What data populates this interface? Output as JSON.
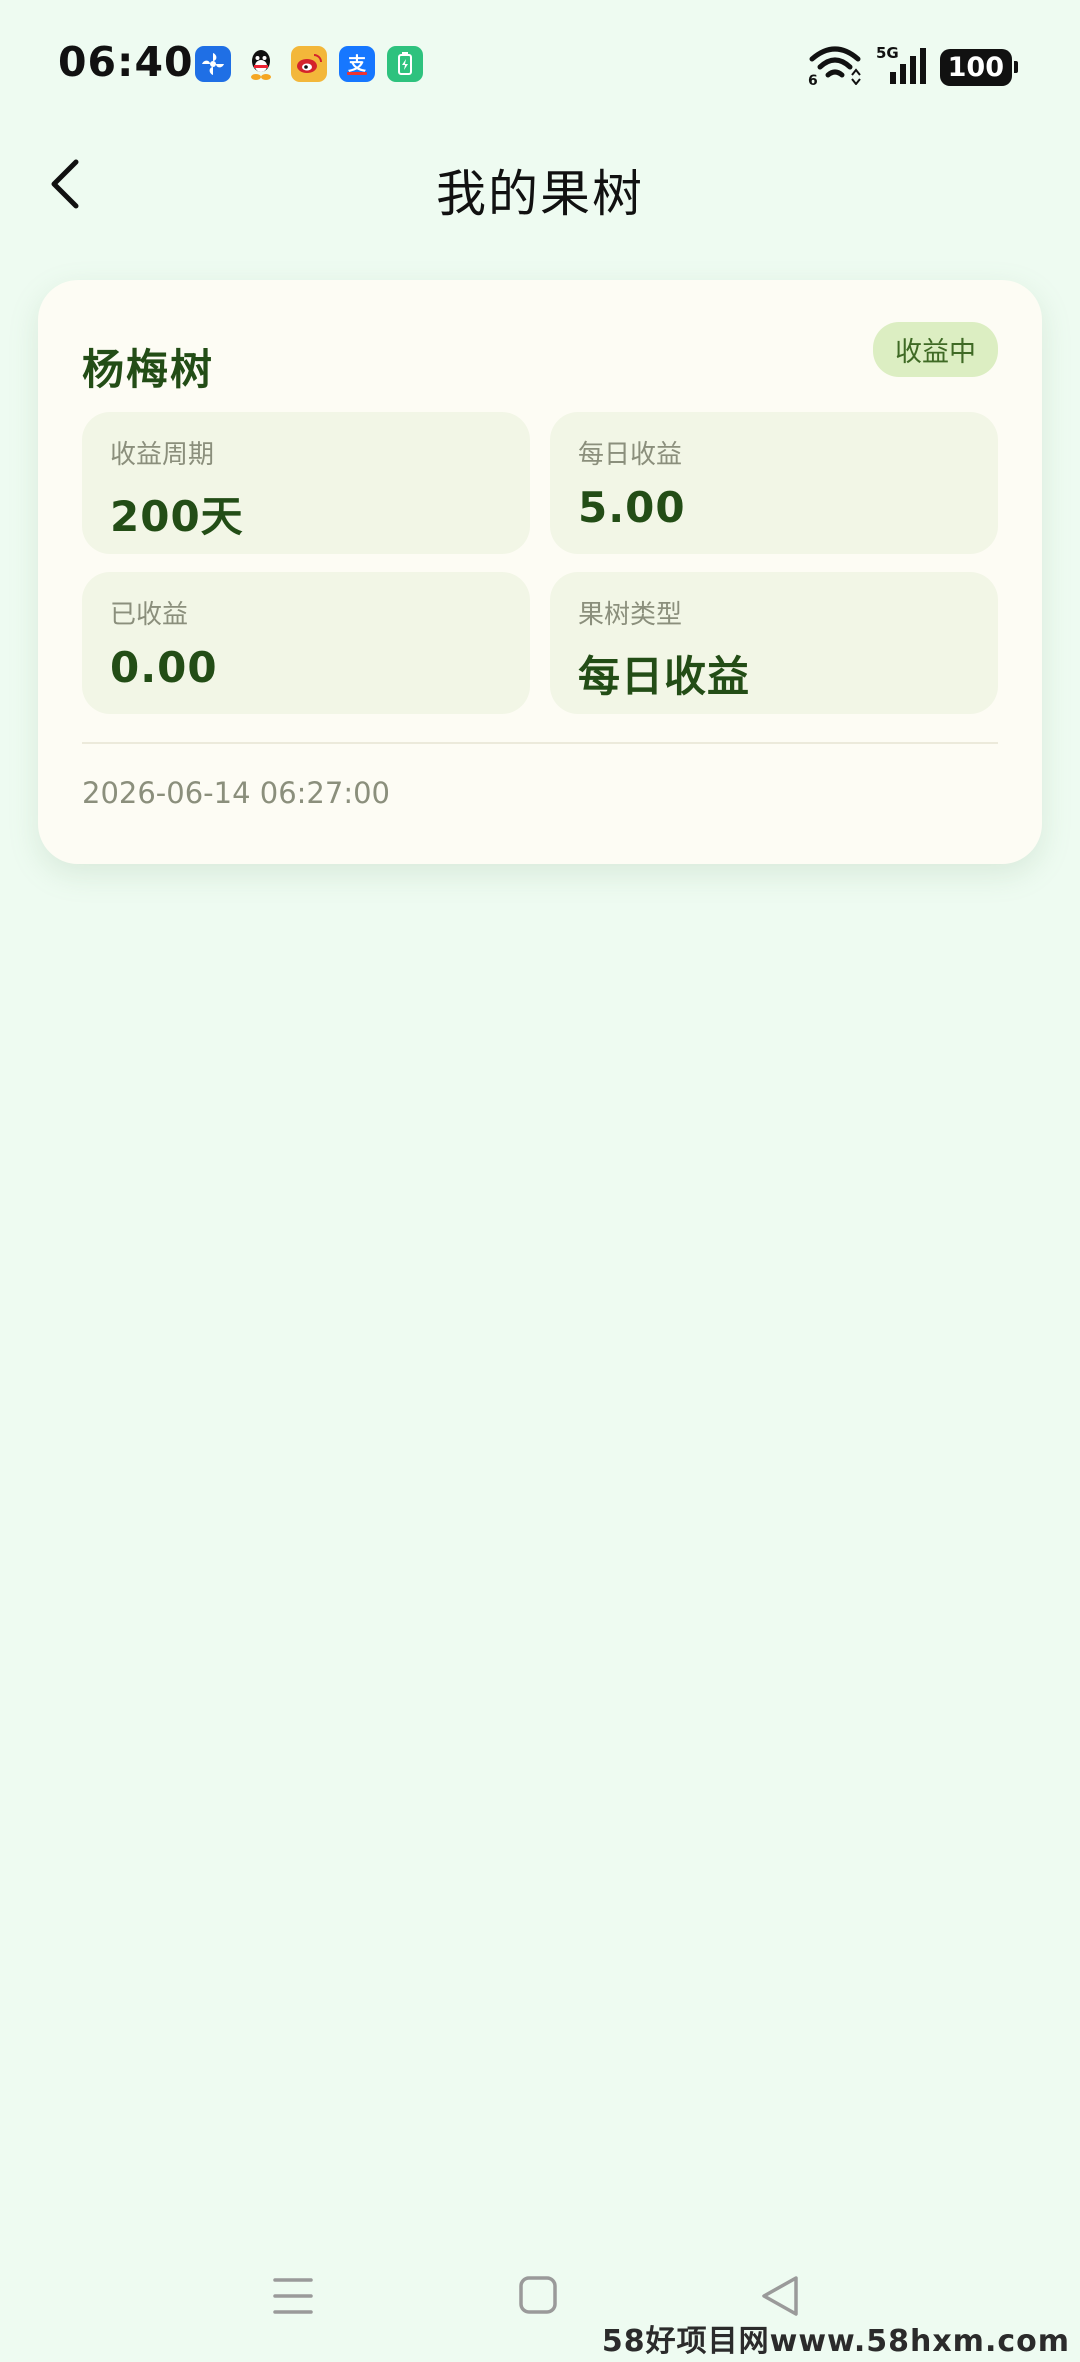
{
  "status_bar": {
    "time": "06:40",
    "apps": [
      "fan-app-icon",
      "qq-icon",
      "weibo-icon",
      "alipay-icon",
      "battery-app-icon"
    ],
    "signal": "5G",
    "wifi_badge": "6",
    "battery": "100"
  },
  "header": {
    "title": "我的果树",
    "back_icon": "chevron-left-icon"
  },
  "card": {
    "name": "杨梅树",
    "status": "收益中",
    "stats": [
      {
        "label": "收益周期",
        "value": "200天"
      },
      {
        "label": "每日收益",
        "value": "5.00"
      },
      {
        "label": "已收益",
        "value": "0.00"
      },
      {
        "label": "果树类型",
        "value": "每日收益"
      }
    ],
    "date": "2026-06-14 06:27:00"
  },
  "nav": {
    "buttons": [
      "menu-icon",
      "home-icon",
      "back-triangle-icon"
    ]
  },
  "watermark": "58好项目网www.58hxm.com",
  "colors": {
    "background": "#eefbf1",
    "card": "#fdfcf4",
    "accent_dark_green": "#234d16",
    "badge_bg": "#dceec2"
  }
}
